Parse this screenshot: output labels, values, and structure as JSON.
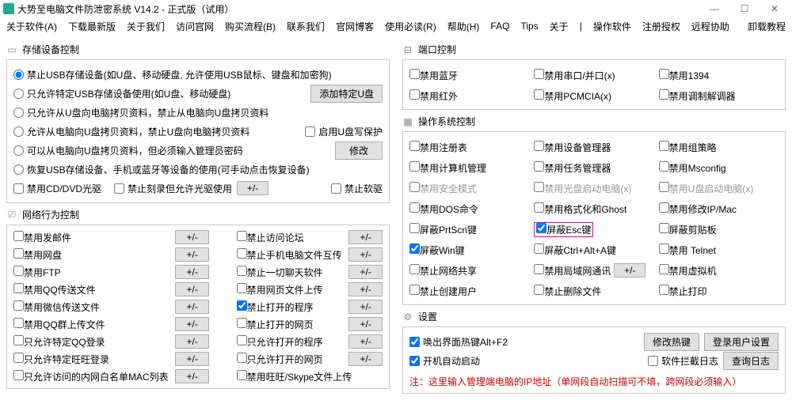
{
  "title": "大势至电脑文件防泄密系统 V14.2 - 正式版（试用）",
  "win": {
    "min": "—",
    "max": "☐",
    "close": "✕"
  },
  "menu": [
    "关于软件(A)",
    "下载最新版",
    "关于我们",
    "访问官网",
    "购买流程(B)",
    "联系我们",
    "官网博客",
    "使用必读(R)",
    "帮助(H)",
    "FAQ",
    "Tips",
    "关于",
    "操作软件",
    "注册授权",
    "远程协助"
  ],
  "menu_right": "卸载教程",
  "sec_storage": "存储设备控制",
  "storage": {
    "r1": "禁止USB存储设备(如U盘、移动硬盘, 允许使用USB鼠标、键盘和加密狗)",
    "r2": "只允许特定USB存储设备使用(如U盘、移动硬盘)",
    "btn_addU": "添加特定U盘",
    "r3": "只允许从U盘向电脑拷贝资料，禁止从电脑向U盘拷贝资料",
    "r4": "允许从电脑向U盘拷贝资料，禁止U盘向电脑拷贝资料",
    "cb_uw": "启用U盘写保护",
    "r5": "可以从电脑向U盘拷贝资料，但必须输入管理员密码",
    "btn_mod": "修改",
    "r6": "恢复USB存储设备、手机或蓝牙等设备的使用(可手动点击恢复设备)",
    "cb_cd": "禁用CD/DVD光驱",
    "cb_burn": "禁止刻录但允许光驱使用",
    "pm": "+/-",
    "cb_floppy": "禁止软驱"
  },
  "sec_net": "网络行为控制",
  "net": {
    "rows": [
      {
        "l": "禁用发邮件",
        "r": "禁止访问论坛"
      },
      {
        "l": "禁用网盘",
        "r": "禁止手机电脑文件互传"
      },
      {
        "l": "禁用FTP",
        "r": "禁止一切聊天软件"
      },
      {
        "l": "禁用QQ传送文件",
        "r": "禁用网页文件上传"
      },
      {
        "l": "禁用微信传送文件",
        "r": "禁止打开的程序",
        "rchecked": true
      },
      {
        "l": "禁用QQ群上传文件",
        "r": "禁止打开的网页"
      },
      {
        "l": "只允许特定QQ登录",
        "r": "只允许打开的程序"
      },
      {
        "l": "只允许特定旺旺登录",
        "r": "只允许打开的网页"
      }
    ],
    "last_l": "只允许访问的内网白名单MAC列表",
    "last_r": "禁用旺旺/Skype文件上传",
    "pm": "+/-"
  },
  "sec_port": "端口控制",
  "port": [
    [
      "禁用蓝牙",
      "禁用串口/并口(x)",
      "禁用1394"
    ],
    [
      "禁用红外",
      "禁用PCMCIA(x)",
      "禁用调制解调器"
    ]
  ],
  "sec_os": "操作系统控制",
  "os": [
    [
      {
        "t": "禁用注册表"
      },
      {
        "t": "禁用设备管理器"
      },
      {
        "t": "禁用组策略"
      }
    ],
    [
      {
        "t": "禁用计算机管理"
      },
      {
        "t": "禁用任务管理器"
      },
      {
        "t": "禁用Msconfig"
      }
    ],
    [
      {
        "t": "禁用安全模式",
        "g": true
      },
      {
        "t": "禁用光盘启动电脑(x)",
        "g": true
      },
      {
        "t": "禁用U盘启动电脑(x)",
        "g": true
      }
    ],
    [
      {
        "t": "禁用DOS命令"
      },
      {
        "t": "禁用格式化和Ghost"
      },
      {
        "t": "禁用修改IP/Mac"
      }
    ],
    [
      {
        "t": "屏蔽PrtScn键"
      },
      {
        "t": "屏蔽Esc键",
        "c": true,
        "hl": true
      },
      {
        "t": "屏蔽剪贴板"
      }
    ],
    [
      {
        "t": "屏蔽Win键",
        "c": true
      },
      {
        "t": "屏蔽Ctrl+Alt+A键"
      },
      {
        "t": "禁用 Telnet"
      }
    ],
    [
      {
        "t": "禁止网络共享"
      },
      {
        "t": "禁用局域网通讯",
        "pm": true
      },
      {
        "t": "禁用虚拟机"
      }
    ],
    [
      {
        "t": "禁止创建用户"
      },
      {
        "t": "禁止删除文件"
      },
      {
        "t": "禁止打印"
      }
    ]
  ],
  "pm": "+/-",
  "sec_set": "设置",
  "set": {
    "hot": "唤出界面热键Alt+F2",
    "btn_hot": "修改热键",
    "btn_login": "登录用户设置",
    "auto": "开机自动启动",
    "cb_log": "软件拦截日志",
    "btn_log": "查询日志",
    "note": "注：这里输入管理端电脑的IP地址（单网段自动扫描可不填，跨网段必须输入）"
  }
}
